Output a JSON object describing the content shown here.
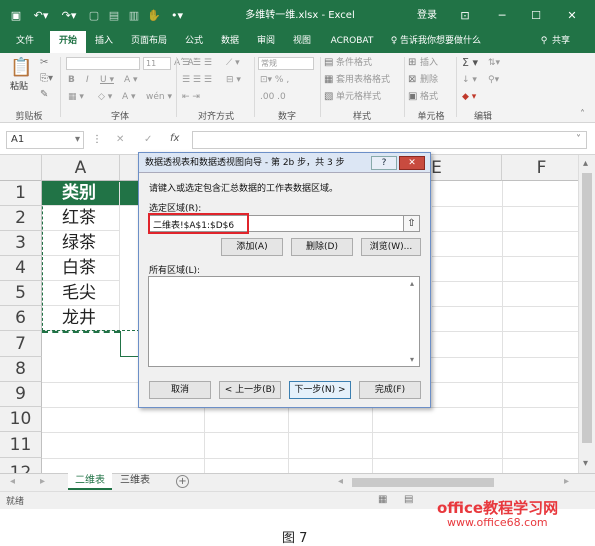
{
  "titlebar": {
    "title": "多维转一维.xlsx - Excel",
    "login": "登录",
    "minimize": "─",
    "restore": "☐",
    "close": "✕"
  },
  "tabs": [
    "文件",
    "开始",
    "插入",
    "页面布局",
    "公式",
    "数据",
    "审阅",
    "视图",
    "ACROBAT"
  ],
  "tell_me": "告诉我你想要做什么",
  "share": "共享",
  "ribbon": {
    "paste": "粘贴",
    "groups": [
      "剪贴板",
      "字体",
      "对齐方式",
      "数字",
      "样式",
      "单元格",
      "编辑"
    ],
    "font_size": "11",
    "number_format": "常规",
    "cond_format": "条件格式",
    "table_format": "套用表格格式",
    "cell_styles": "单元格样式",
    "insert": "插入",
    "delete": "删除",
    "format": "格式"
  },
  "formula_bar": {
    "name_box": "A1",
    "fx": "fx",
    "cancel": "✕",
    "enter": "✓"
  },
  "grid": {
    "columns": [
      "A",
      "B",
      "C",
      "D",
      "E",
      "F"
    ],
    "rows": [
      "1",
      "2",
      "3",
      "4",
      "5",
      "6",
      "7",
      "8",
      "9",
      "10",
      "11",
      "12"
    ],
    "col_a": [
      "类别",
      "红茶",
      "绿茶",
      "白茶",
      "毛尖",
      "龙井"
    ]
  },
  "dialog": {
    "title": "数据透视表和数据透视图向导 - 第 2b 步，共 3 步",
    "help": "?",
    "close": "✕",
    "prompt": "请键入或选定包含汇总数据的工作表数据区域。",
    "range_label": "选定区域(R):",
    "range_value": "二维表!$A$1:$D$6",
    "add": "添加(A)",
    "delete": "删除(D)",
    "browse": "浏览(W)...",
    "all_ranges": "所有区域(L):",
    "cancel": "取消",
    "back": "< 上一步(B)",
    "next": "下一步(N) >",
    "finish": "完成(F)"
  },
  "sheets": [
    "二维表",
    "三维表"
  ],
  "status": "就绪",
  "watermark": {
    "line1": "office教程学习网",
    "line2": "www.office68.com"
  },
  "caption": "图 7"
}
